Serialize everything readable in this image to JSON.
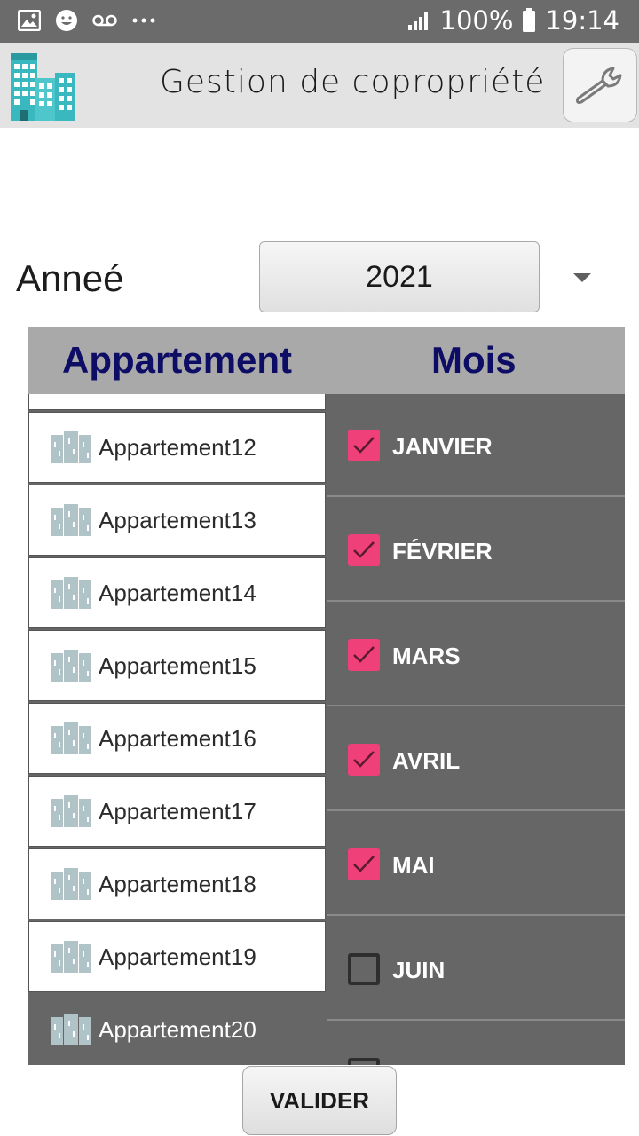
{
  "status_bar": {
    "icons_left": [
      "image-icon",
      "face-icon",
      "voicemail-icon",
      "more-dots-icon"
    ],
    "battery": "100%",
    "time": "19:14"
  },
  "app_bar": {
    "title": "Gestion de copropriété",
    "logo_icon": "buildings-icon",
    "settings_icon": "wrench-icon"
  },
  "year": {
    "label": "Anneé",
    "selected": "2021"
  },
  "table": {
    "col_apartment": "Appartement",
    "col_month": "Mois"
  },
  "apartments": [
    {
      "name": "Appartement12",
      "selected": false
    },
    {
      "name": "Appartement13",
      "selected": false
    },
    {
      "name": "Appartement14",
      "selected": false
    },
    {
      "name": "Appartement15",
      "selected": false
    },
    {
      "name": "Appartement16",
      "selected": false
    },
    {
      "name": "Appartement17",
      "selected": false
    },
    {
      "name": "Appartement18",
      "selected": false
    },
    {
      "name": "Appartement19",
      "selected": false
    },
    {
      "name": "Appartement20",
      "selected": true
    }
  ],
  "months": [
    {
      "label": "JANVIER",
      "checked": true
    },
    {
      "label": "FÉVRIER",
      "checked": true
    },
    {
      "label": "MARS",
      "checked": true
    },
    {
      "label": "AVRIL",
      "checked": true
    },
    {
      "label": "MAI",
      "checked": true
    },
    {
      "label": "JUIN",
      "checked": false
    },
    {
      "label": "",
      "checked": false
    }
  ],
  "colors": {
    "checkbox_checked": "#f0407a",
    "header_text": "#0d0d66",
    "panel_dark": "#666666"
  },
  "buttons": {
    "submit": "VALIDER"
  }
}
